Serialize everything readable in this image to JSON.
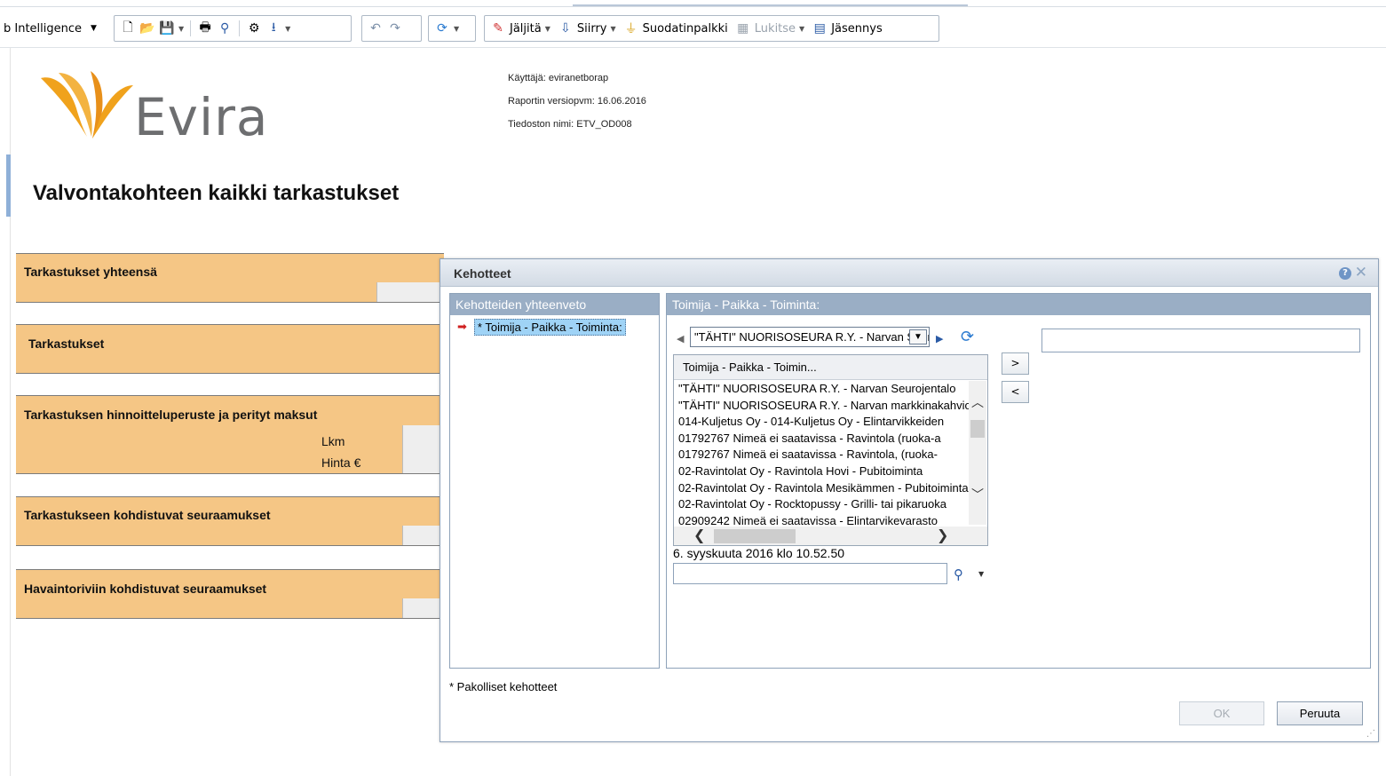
{
  "toolbar": {
    "app_title": "b Intelligence",
    "track_label": "Jäljitä",
    "goto_label": "Siirry",
    "filterbar_label": "Suodatinpalkki",
    "lock_label": "Lukitse",
    "outline_label": "Jäsennys"
  },
  "report": {
    "logo_text": "Evira",
    "user_line": "Käyttäjä: eviranetborap",
    "version_line": "Raportin versiopvm: 16.06.2016",
    "file_line": "Tiedoston nimi: ETV_OD008",
    "title": "Valvontakohteen kaikki tarkastukset",
    "sections": {
      "s1": "Tarkastukset yhteensä",
      "s2": "Tarkastukset",
      "s3": "Tarkastuksen hinnoitteluperuste ja perityt maksut",
      "s3_lkm": "Lkm",
      "s3_hinta": "Hinta €",
      "s4": "Tarkastukseen kohdistuvat seuraamukset",
      "s5": "Havaintoriviin kohdistuvat seuraamukset"
    }
  },
  "dialog": {
    "title": "Kehotteet",
    "summary_header": "Kehotteiden yhteenveto",
    "summary_item": "* Toimija - Paikka - Toiminta:",
    "detail_header": "Toimija - Paikka - Toiminta:",
    "combo_value": "\"TÄHTI\" NUORISOSEURA R.Y. - Narvan Seurojentalo",
    "list_header": "Toimija - Paikka - Toimin...",
    "list_rows": [
      "\"TÄHTI\" NUORISOSEURA R.Y. - Narvan Seurojentalo",
      "\"TÄHTI\" NUORISOSEURA R.Y. - Narvan markkinakahvio",
      "014-Kuljetus Oy - 014-Kuljetus Oy - Elintarvikkeiden",
      "01792767 Nimeä ei saatavissa - Ravintola (ruoka-a",
      "01792767 Nimeä ei saatavissa - Ravintola, (ruoka-",
      "02-Ravintolat Oy - Ravintola Hovi - Pubitoiminta",
      "02-Ravintolat Oy - Ravintola Mesikämmen - Pubitoiminta",
      "02-Ravintolat Oy - Rocktopussy - Grilli- tai pikaruoka",
      "02909242 Nimeä ei saatavissa - Elintarvikevarasto"
    ],
    "timestamp": "6. syyskuuta 2016 klo 10.52.50",
    "add_label": ">",
    "remove_label": "<",
    "required_note": "* Pakolliset kehotteet",
    "ok_label": "OK",
    "cancel_label": "Peruuta"
  },
  "colors": {
    "section_fill": "#f5c685",
    "dialog_header": "#9aaec5",
    "selection": "#9fd3f6",
    "logo_orange": "#f0a21c"
  }
}
